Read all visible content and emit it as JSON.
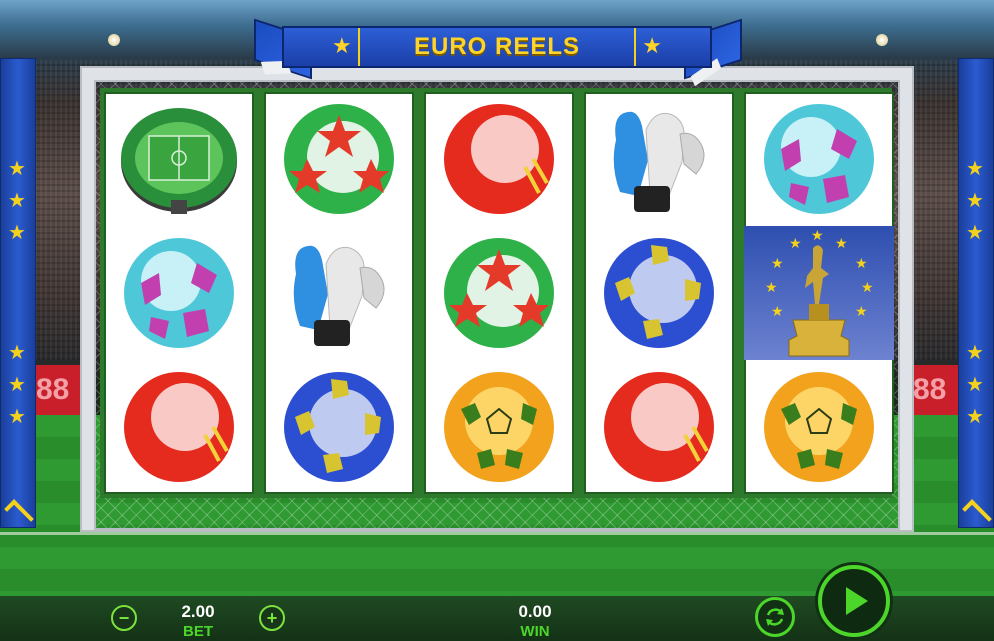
{
  "game": {
    "title": "EURO REELS"
  },
  "controls": {
    "bet_value": "2.00",
    "bet_label": "BET",
    "win_value": "0.00",
    "win_label": "WIN",
    "minus_symbol": "−",
    "plus_symbol": "+"
  },
  "reels": [
    [
      "stadium",
      "ball-teal-purple",
      "ball-red"
    ],
    [
      "ball-green-red-stars",
      "goalkeeper-gloves",
      "ball-blue-yellow"
    ],
    [
      "ball-red",
      "ball-green-red-stars",
      "ball-orange-green"
    ],
    [
      "goalkeeper-gloves",
      "ball-blue-yellow",
      "ball-red"
    ],
    [
      "ball-teal-purple",
      "trophy",
      "ball-orange-green"
    ]
  ],
  "colors": {
    "accent_green": "#4cd62a",
    "title_gold": "#ffd42a",
    "banner_blue": "#1b3fa8"
  },
  "icons": {
    "minus": "minus-circle-icon",
    "plus": "plus-circle-icon",
    "autoplay": "autoplay-arrows-icon",
    "spin": "play-triangle-icon"
  }
}
